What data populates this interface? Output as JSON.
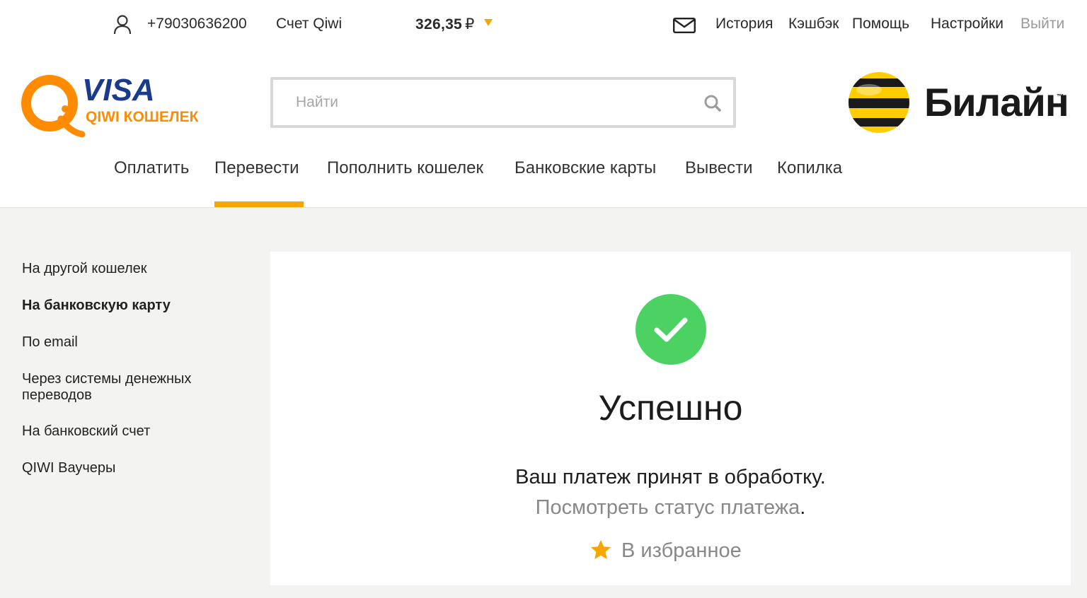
{
  "topbar": {
    "user_icon": "user-icon",
    "phone": "+79030636200",
    "account_label": "Счет Qiwi",
    "balance": "326,35",
    "currency": "₽",
    "mail_icon": "envelope-icon",
    "links": {
      "history": "История",
      "cashback": "Кэшбэк",
      "help": "Помощь",
      "settings": "Настройки",
      "logout": "Выйти"
    }
  },
  "logo": {
    "brand_line1": "VISA",
    "brand_line2": "QIWI КОШЕЛЕК"
  },
  "search": {
    "placeholder": "Найти",
    "icon": "search-icon"
  },
  "operator": {
    "name": "Билайн",
    "tm": "™"
  },
  "main_nav": {
    "pay": "Оплатить",
    "transfer": "Перевести",
    "topup": "Пополнить кошелек",
    "cards": "Банковские карты",
    "withdraw": "Вывести",
    "piggy": "Копилка",
    "active": "transfer"
  },
  "sidebar": {
    "items": [
      {
        "label": "На другой кошелек",
        "active": false
      },
      {
        "label": "На банковскую карту",
        "active": true
      },
      {
        "label": "По email",
        "active": false
      },
      {
        "label": "Через системы денежных переводов",
        "active": false
      },
      {
        "label": "На банковский счет",
        "active": false
      },
      {
        "label": "QIWI Ваучеры",
        "active": false
      }
    ]
  },
  "result": {
    "title": "Успешно",
    "message": "Ваш платеж принят в обработку.",
    "status_link": "Посмотреть статус платежа",
    "status_dot": ".",
    "favorite_label": "В избранное",
    "favorite_icon": "star-icon"
  },
  "colors": {
    "accent": "#f7a600",
    "success": "#4bd263",
    "qiwi_orange": "#ff8c00",
    "visa_blue": "#1a3a8c",
    "background": "#f3f3f2"
  }
}
